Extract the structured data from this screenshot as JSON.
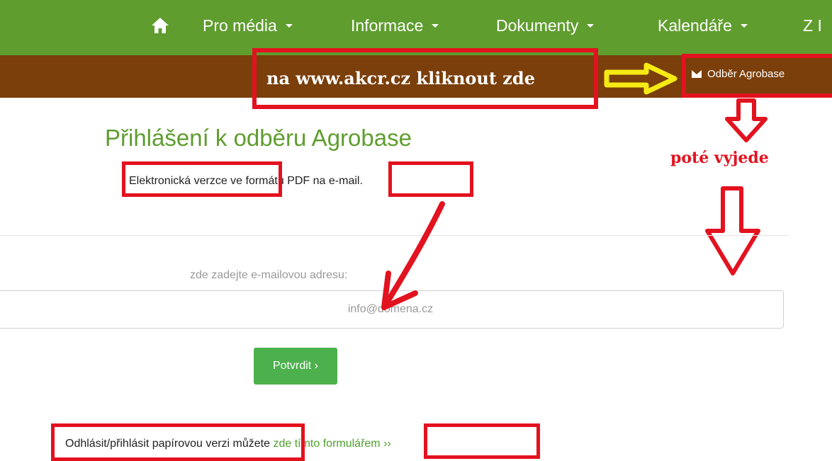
{
  "nav": {
    "items": [
      {
        "label": "Pro média"
      },
      {
        "label": "Informace"
      },
      {
        "label": "Dokumenty"
      },
      {
        "label": "Kalendáře"
      },
      {
        "label": "Z I"
      }
    ],
    "home_icon": "home-icon"
  },
  "banner": {
    "annotation_text": "na www.akcr.cz kliknout zde",
    "odber_link": "Odběr Agrobase",
    "mail_icon": "envelope-icon"
  },
  "annotation": {
    "pote_vyjede": "poté vyjede",
    "color": "#e3121f",
    "arrow_yellow": "#f5ea14"
  },
  "main": {
    "title": "Přihlášení k odběru Agrobase",
    "desc_part1": "Elektronická verzce",
    "desc_part2": " ve formátu PDF ",
    "desc_part3": "na e-mail.",
    "email_label": "zde zadejte e-mailovou adresu:",
    "email_placeholder": "info@domena.cz",
    "submit_label": "Potvrdit ›"
  },
  "footer": {
    "part1": "Odhlásit/přihlásit papírovou verzi",
    "part2": " můžete ",
    "part3": "zde tímto ",
    "part4": "formulářem ››"
  },
  "colors": {
    "nav_green": "#5f9d2f",
    "banner_brown": "#7a3f0a",
    "button_green": "#4cb04c"
  }
}
